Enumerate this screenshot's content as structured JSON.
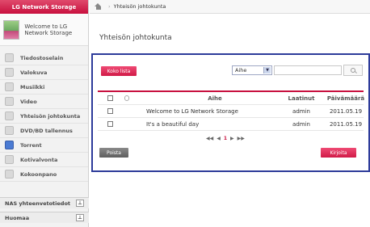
{
  "sidebar": {
    "app_title": "LG Network Storage",
    "welcome": "Welcome to LG Network Storage",
    "items": [
      {
        "label": "Tiedostoselain",
        "icon": "folder-icon"
      },
      {
        "label": "Valokuva",
        "icon": "photo-icon"
      },
      {
        "label": "Musiikki",
        "icon": "music-icon"
      },
      {
        "label": "Video",
        "icon": "video-icon"
      },
      {
        "label": "Yhteisön johtokunta",
        "icon": "board-icon"
      },
      {
        "label": "DVD/BD tallennus",
        "icon": "disc-icon"
      },
      {
        "label": "Torrent",
        "icon": "torrent-icon"
      },
      {
        "label": "Kotivalvonta",
        "icon": "camera-icon"
      },
      {
        "label": "Kokoonpano",
        "icon": "settings-icon"
      }
    ],
    "bottom": [
      {
        "label": "NAS yhteenvetotiedot"
      },
      {
        "label": "Huomaa"
      }
    ]
  },
  "breadcrumb": {
    "current": "Yhteisön johtokunta"
  },
  "main": {
    "title": "Yhteisön johtokunta",
    "list_button": "Koko lista",
    "search_field": "Aihe",
    "columns": {
      "title": "Aihe",
      "author": "Laatinut",
      "date": "Päivämäärä"
    },
    "rows": [
      {
        "title": "Welcome to LG Network Storage",
        "author": "admin",
        "date": "2011.05.19"
      },
      {
        "title": "It's a beautiful day",
        "author": "admin",
        "date": "2011.05.19"
      }
    ],
    "pager": {
      "first": "◀◀",
      "prev": "◀",
      "page": "1",
      "next": "▶",
      "last": "▶▶"
    },
    "delete_button": "Poista",
    "write_button": "Kirjoita"
  }
}
